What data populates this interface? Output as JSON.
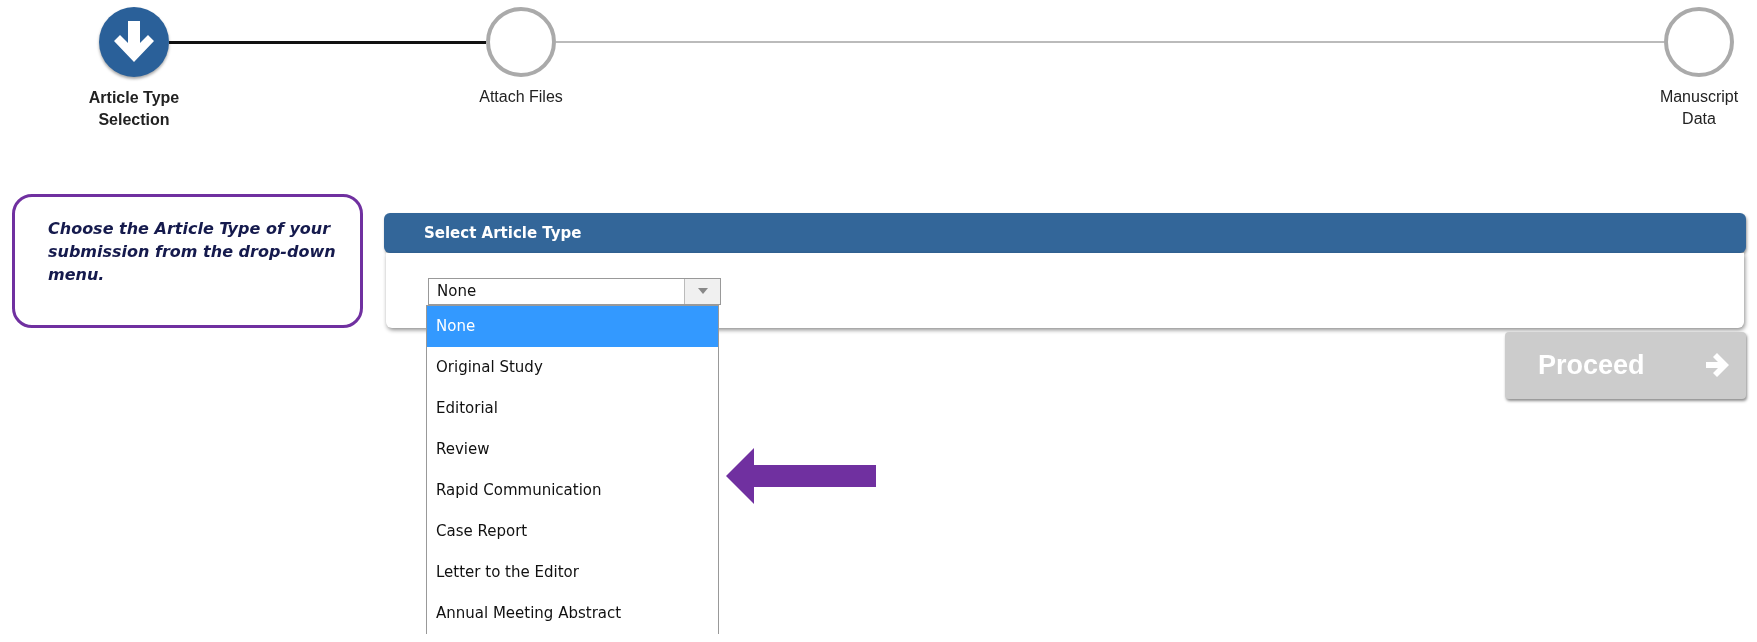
{
  "steps": [
    {
      "label": "Article Type Selection",
      "current": true
    },
    {
      "label": "Attach Files",
      "current": false
    },
    {
      "label": "Manuscript Data",
      "current": false
    }
  ],
  "instruction": "Choose the Article Type of your submission from the drop-down menu.",
  "panel": {
    "title": "Select Article Type",
    "select": {
      "value": "None",
      "open": true,
      "options": [
        {
          "label": "None",
          "selected": true
        },
        {
          "label": "Original Study",
          "selected": false
        },
        {
          "label": "Editorial",
          "selected": false
        },
        {
          "label": "Review",
          "selected": false
        },
        {
          "label": "Rapid Communication",
          "selected": false
        },
        {
          "label": "Case Report",
          "selected": false
        },
        {
          "label": "Letter to the Editor",
          "selected": false
        },
        {
          "label": "Annual Meeting Abstract",
          "selected": false
        }
      ]
    }
  },
  "proceed_button": {
    "label": "Proceed",
    "disabled": true
  }
}
